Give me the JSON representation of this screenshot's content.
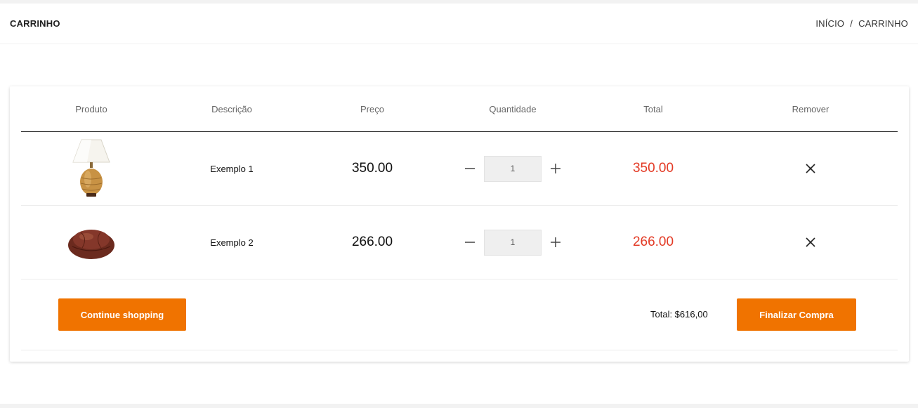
{
  "header": {
    "title": "CARRINHO",
    "breadcrumb": {
      "home": "INÍCIO",
      "separator": "/",
      "current": "CARRINHO"
    }
  },
  "table": {
    "columns": [
      "Produto",
      "Descrição",
      "Preço",
      "Quantidade",
      "Total",
      "Remover"
    ],
    "rows": [
      {
        "image": "table-lamp",
        "description": "Exemplo 1",
        "price": "350.00",
        "quantity": "1",
        "total": "350.00"
      },
      {
        "image": "leather-bean-bag",
        "description": "Exemplo 2",
        "price": "266.00",
        "quantity": "1",
        "total": "266.00"
      }
    ]
  },
  "footer": {
    "continue_label": "Continue shopping",
    "grand_total": "Total: $616,00",
    "checkout_label": "Finalizar Compra"
  },
  "colors": {
    "accent": "#f07300",
    "total_red": "#e33b26"
  }
}
